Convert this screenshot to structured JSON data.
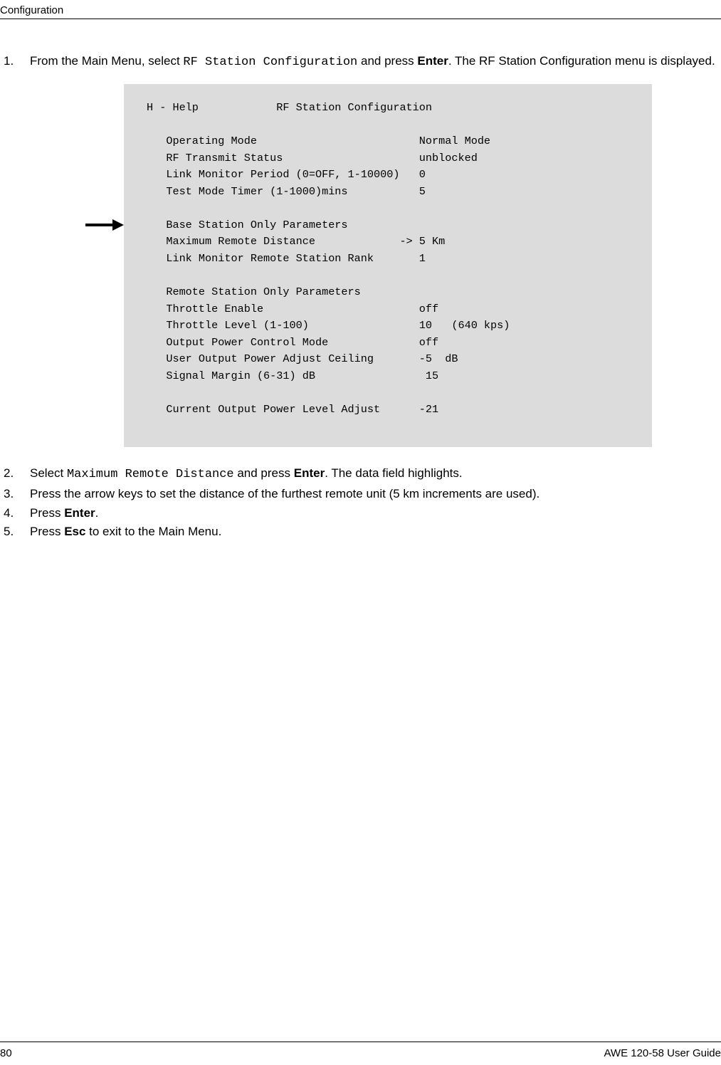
{
  "header": {
    "section": "Configuration"
  },
  "steps": {
    "s1": {
      "num": "1.",
      "pre": "From the Main Menu, select ",
      "code": "RF Station Configuration",
      "mid": " and press ",
      "bold": "Enter",
      "post": ". The RF Station Configuration menu is displayed."
    },
    "s2": {
      "num": "2.",
      "pre": "Select ",
      "code": "Maximum Remote Distance",
      "mid": " and press ",
      "bold": "Enter",
      "post": ". The data field highlights."
    },
    "s3": {
      "num": "3.",
      "text": "Press the arrow keys to set the distance of the furthest remote unit (5 km increments are used)."
    },
    "s4": {
      "num": "4.",
      "pre": "Press ",
      "bold": "Enter",
      "post": "."
    },
    "s5": {
      "num": "5.",
      "pre": "Press ",
      "bold": "Esc",
      "post": " to exit to the Main Menu."
    }
  },
  "terminal": {
    "text": "H - Help            RF Station Configuration\n\n   Operating Mode                         Normal Mode\n   RF Transmit Status                     unblocked\n   Link Monitor Period (0=OFF, 1-10000)   0\n   Test Mode Timer (1-1000)mins           5\n\n   Base Station Only Parameters\n   Maximum Remote Distance             -> 5 Km\n   Link Monitor Remote Station Rank       1\n\n   Remote Station Only Parameters\n   Throttle Enable                        off\n   Throttle Level (1-100)                 10   (640 kps)\n   Output Power Control Mode              off\n   User Output Power Adjust Ceiling       -5  dB\n   Signal Margin (6-31) dB                 15\n\n   Current Output Power Level Adjust      -21"
  },
  "footer": {
    "page": "80",
    "guide": "AWE 120-58 User Guide"
  }
}
